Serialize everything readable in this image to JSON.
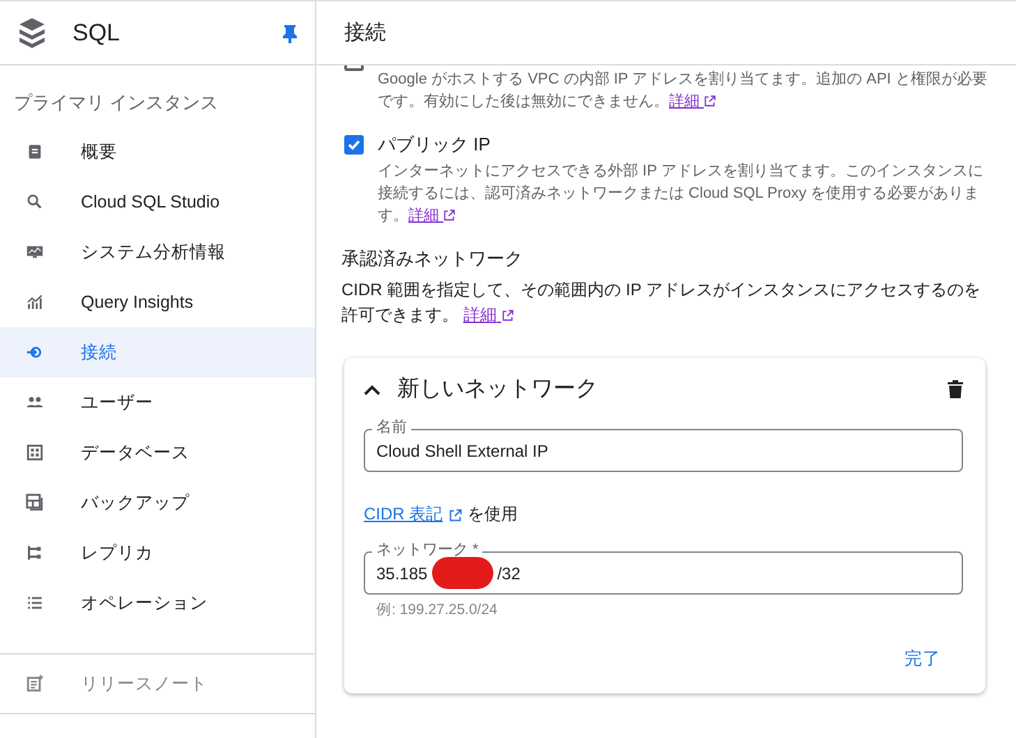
{
  "sidebar": {
    "title": "SQL",
    "pinned": true,
    "section": "プライマリ インスタンス",
    "items": [
      {
        "label": "概要",
        "selected": false
      },
      {
        "label": "Cloud SQL Studio",
        "selected": false
      },
      {
        "label": "システム分析情報",
        "selected": false
      },
      {
        "label": "Query Insights",
        "selected": false
      },
      {
        "label": "接続",
        "selected": true
      },
      {
        "label": "ユーザー",
        "selected": false
      },
      {
        "label": "データベース",
        "selected": false
      },
      {
        "label": "バックアップ",
        "selected": false
      },
      {
        "label": "レプリカ",
        "selected": false
      },
      {
        "label": "オペレーション",
        "selected": false
      }
    ],
    "footer_items": [
      {
        "label": "リリースノート"
      }
    ]
  },
  "page": {
    "title": "接続"
  },
  "options": [
    {
      "checked": false,
      "description": "Google がホストする VPC の内部 IP アドレスを割り当てます。追加の API と権限が必要です。有効にした後は無効にできません。",
      "link": "詳細"
    },
    {
      "label": "パブリック IP",
      "checked": true,
      "description": "インターネットにアクセスできる外部 IP アドレスを割り当てます。このインスタンスに接続するには、認可済みネットワークまたは Cloud SQL Proxy を使用する必要があります。",
      "link": "詳細"
    }
  ],
  "authorized_networks": {
    "title": "承認済みネットワーク",
    "description": "CIDR 範囲を指定して、その範囲内の IP アドレスがインスタンスにアクセスするのを許可できます。",
    "link": "詳細"
  },
  "network_card": {
    "title": "新しいネットワーク",
    "expanded": true,
    "name_field": {
      "label": "名前",
      "value": "Cloud Shell External IP"
    },
    "cidr_link": "CIDR 表記",
    "cidr_suffix": "を使用",
    "network_field": {
      "label": "ネットワーク *",
      "value_start": "35.185",
      "value_end": "/32",
      "redacted": true,
      "hint": "例: 199.27.25.0/24"
    },
    "done_button": "完了"
  }
}
